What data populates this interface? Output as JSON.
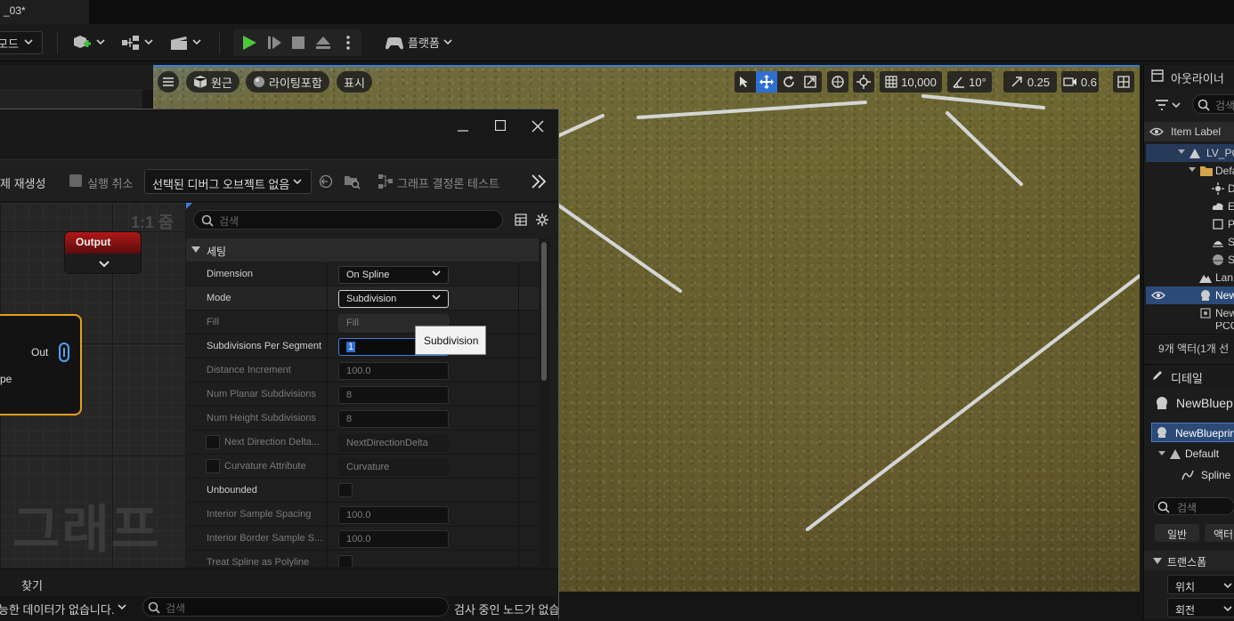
{
  "tab": {
    "title": "_03*"
  },
  "toolbar": {
    "mode_label": "모드",
    "platform_label": "플랫폼"
  },
  "viewport": {
    "perspective_label": "원근",
    "lighting_label": "라이팅포함",
    "show_label": "표시",
    "grid_value": "10,000",
    "angle_value": "10°",
    "scale_value": "0.25",
    "camera_value": "0.6"
  },
  "pcg": {
    "regenerate_label": "제 재생성",
    "undo_label": "실행 취소",
    "debug_select": "선택된 디버그 오브젝트 없음",
    "determinism_test": "그래프 결정론 테스트",
    "zoom_label": "1:1 줌",
    "watermark": "그래프",
    "node_output_title": "Output",
    "node_out_pin": "Out",
    "node_partial_label": "pe",
    "search_placeholder": "검색",
    "section_settings": "세팅",
    "tooltip": "Subdivision",
    "props": [
      {
        "name": "Dimension",
        "value": "On Spline"
      },
      {
        "name": "Mode",
        "value": "Subdivision"
      },
      {
        "name": "Fill",
        "value": "Fill"
      },
      {
        "name": "Subdivisions Per Segment",
        "value": "1"
      },
      {
        "name": "Distance Increment",
        "value": "100.0"
      },
      {
        "name": "Num Planar Subdivisions",
        "value": "8"
      },
      {
        "name": "Num Height Subdivisions",
        "value": "8"
      },
      {
        "name": "Next Direction Delta...",
        "value": "NextDirectionDelta"
      },
      {
        "name": "Curvature Attribute",
        "value": "Curvature"
      },
      {
        "name": "Unbounded",
        "value": ""
      },
      {
        "name": "Interior Sample Spacing",
        "value": "100.0"
      },
      {
        "name": "Interior Border Sample S...",
        "value": "100.0"
      },
      {
        "name": "Treat Spline as Polyline",
        "value": ""
      }
    ],
    "bottom": {
      "find_label": "찾기",
      "no_data_label": "능한 데이터가 없습니다.",
      "search_placeholder": "검색",
      "searching_label": "검사 중인 노드가 없습"
    }
  },
  "outliner": {
    "title": "아웃라이너",
    "search_placeholder": "검색",
    "column_label": "Item Label",
    "items": [
      "LV_PC",
      "Defa",
      "D",
      "E",
      "P",
      "S",
      "S",
      "Lan",
      "New",
      "New",
      "PCG"
    ],
    "actor_count": "9개 액터(1개 선",
    "details_title": "디테일",
    "details_object": "NewBluep",
    "details_root": "NewBlueprin",
    "details_child1": "Default",
    "details_child2": "Spline",
    "details_search": "검색",
    "tab_general": "일반",
    "tab_actor": "액터",
    "transform_label": "트랜스폼",
    "location_label": "위치",
    "rotation_label": "회전"
  }
}
